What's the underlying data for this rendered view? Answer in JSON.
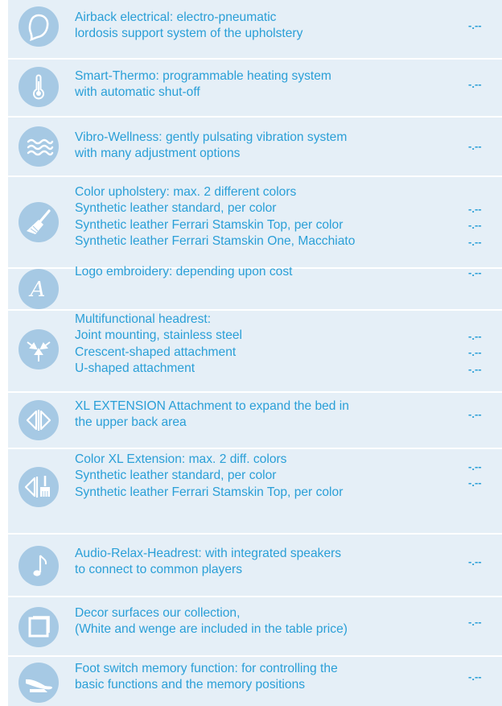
{
  "items": [
    {
      "icon": "airback-icon",
      "lines": [
        "Airback electrical: electro-pneumatic",
        "lordosis support system of the upholstery"
      ],
      "prices": [
        "-.--"
      ]
    },
    {
      "icon": "thermometer-icon",
      "lines": [
        "Smart-Thermo: programmable heating system",
        "with automatic shut-off"
      ],
      "prices": [
        "-.--"
      ]
    },
    {
      "icon": "vibration-waves-icon",
      "lines": [
        "Vibro-Wellness: gently pulsating vibration system",
        "with many adjustment options"
      ],
      "prices": [
        "-.--"
      ]
    },
    {
      "icon": "paint-brush-icon",
      "lines": [
        "Color upholstery: max. 2 different colors",
        "Synthetic leather standard, per color",
        "Synthetic leather Ferrari Stamskin Top, per color",
        "Synthetic leather Ferrari Stamskin One, Macchiato"
      ],
      "prices": [
        "-.--",
        "-.--",
        "-.--"
      ]
    },
    {
      "icon": "embroidery-letter-icon",
      "lines": [
        "Logo embroidery: depending upon cost"
      ],
      "prices": [
        "-.--"
      ]
    },
    {
      "icon": "headrest-arrows-icon",
      "lines": [
        "Multifunctional headrest:",
        "Joint mounting, stainless steel",
        "Crescent-shaped attachment",
        "U-shaped attachment"
      ],
      "prices": [
        "-.--",
        "-.--",
        "-.--"
      ]
    },
    {
      "icon": "xl-extension-icon",
      "lines": [
        "XL EXTENSION Attachment to expand the bed in",
        "the upper back area"
      ],
      "prices": [
        "-.--"
      ]
    },
    {
      "icon": "xl-color-brush-icon",
      "lines": [
        "Color XL Extension: max. 2 diff. colors",
        "Synthetic leather standard, per color",
        "Synthetic leather Ferrari Stamskin Top, per color"
      ],
      "prices": [
        "-.--",
        "-.--"
      ]
    },
    {
      "icon": "music-note-icon",
      "lines": [
        "Audio-Relax-Headrest: with integrated speakers",
        "to connect to common players"
      ],
      "prices": [
        "-.--"
      ]
    },
    {
      "icon": "decor-square-icon",
      "lines": [
        "Decor surfaces  our collection,",
        "(White and wenge are included in the table price)"
      ],
      "prices": [
        "-.--"
      ]
    },
    {
      "icon": "foot-switch-icon",
      "lines": [
        "Foot switch memory function: for controlling the",
        "basic functions and the memory positions"
      ],
      "prices": [
        "-.--"
      ]
    }
  ]
}
